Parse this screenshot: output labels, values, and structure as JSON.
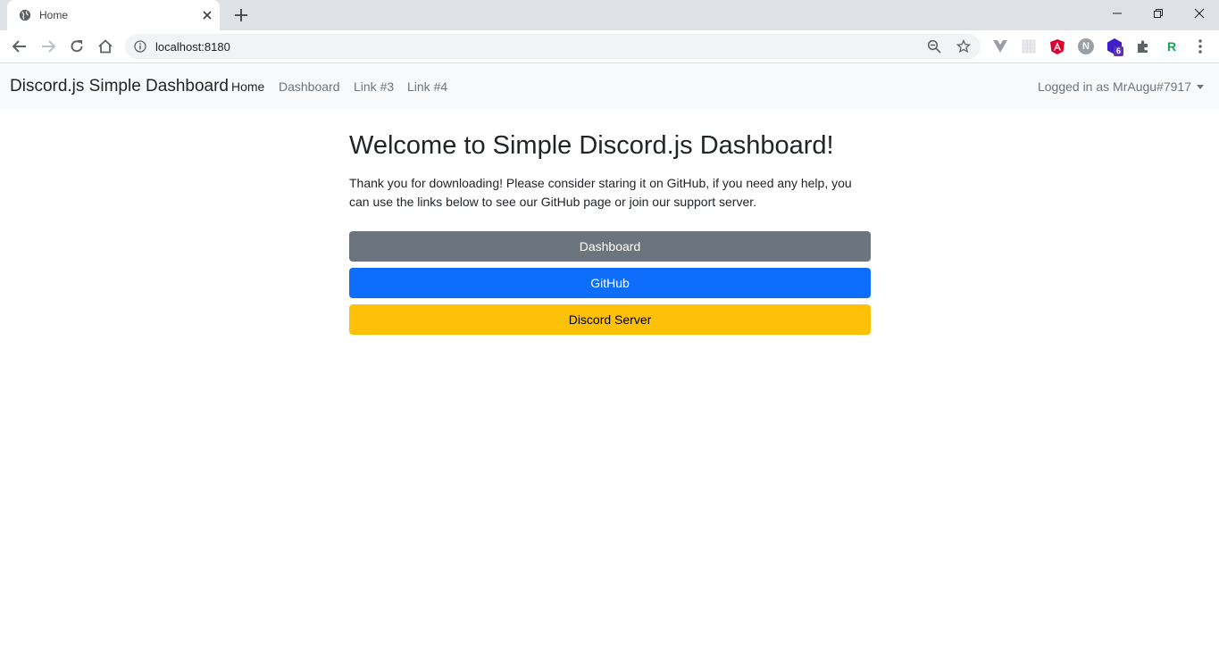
{
  "browser": {
    "tab_title": "Home",
    "url": "localhost:8180",
    "extensions": {
      "badge_count": "6",
      "n_letter": "N",
      "r_letter": "R"
    }
  },
  "navbar": {
    "brand": "Discord.js Simple Dashboard",
    "links": [
      "Home",
      "Dashboard",
      "Link #3",
      "Link #4"
    ],
    "user_status": "Logged in as MrAugu#7917"
  },
  "main": {
    "heading": "Welcome to Simple Discord.js Dashboard!",
    "lead": "Thank you for downloading! Please consider staring it on GitHub, if you need any help, you can use the links below to see our GitHub page or join our support server.",
    "buttons": [
      "Dashboard",
      "GitHub",
      "Discord Server"
    ]
  },
  "colors": {
    "navbar_bg": "#f8f9fa",
    "secondary": "#6c757d",
    "primary": "#0d6efd",
    "warning": "#ffc107"
  }
}
